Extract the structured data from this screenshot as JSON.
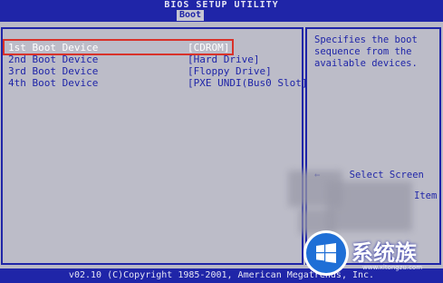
{
  "header": {
    "title": "BIOS SETUP UTILITY",
    "active_tab": "Boot"
  },
  "boot_devices": [
    {
      "label": "1st Boot Device",
      "value": "[CDROM]",
      "selected": true
    },
    {
      "label": "2nd Boot Device",
      "value": "[Hard Drive]",
      "selected": false
    },
    {
      "label": "3rd Boot Device",
      "value": "[Floppy Drive]",
      "selected": false
    },
    {
      "label": "4th Boot Device",
      "value": "[PXE UNDI(Bus0 Slot]",
      "selected": false
    }
  ],
  "help": {
    "text": "Specifies the boot\nsequence from the\navailable devices.",
    "keys": [
      {
        "key": "←",
        "action": "Select Screen"
      },
      {
        "key": "",
        "action": "Item"
      }
    ]
  },
  "footer": {
    "copyright": "v02.10 (C)Copyright 1985-2001, American Megatrends, Inc."
  },
  "watermark": {
    "text": "系统族",
    "url": "www.xitongzu.com"
  },
  "colors": {
    "bios_blue": "#1f25a8",
    "panel_gray": "#bcbcc8",
    "selection_outline": "#d8322a"
  }
}
